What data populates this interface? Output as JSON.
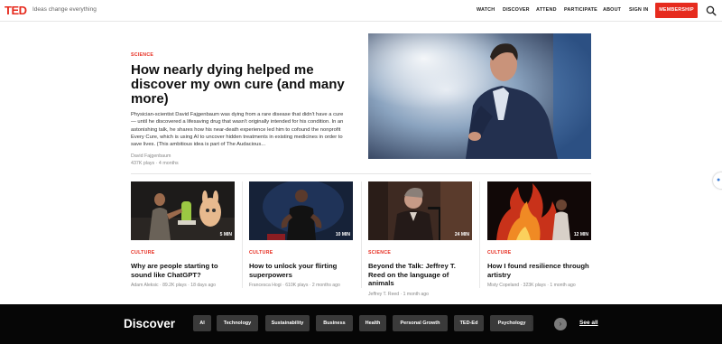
{
  "header": {
    "logo": "TED",
    "tagline": "Ideas change everything",
    "nav": [
      "WATCH",
      "DISCOVER",
      "ATTEND",
      "PARTICIPATE",
      "ABOUT",
      "SIGN IN"
    ],
    "membership_label": "MEMBERSHIP",
    "brand_color": "#e62b1e"
  },
  "hero": {
    "category": "SCIENCE",
    "title": "How nearly dying helped me discover my own cure (and many more)",
    "description": "Physician-scientist David Fajgenbaum was dying from a rare disease that didn't have a cure — until he discovered a lifesaving drug that wasn't originally intended for his condition. In an astonishing talk, he shares how his near-death experience led him to cofound the nonprofit Every Cure, which is using AI to uncover hidden treatments in existing medicines in order to save lives. (This ambitious idea is part of The Audacious...",
    "speaker": "David Fajgenbaum",
    "stats": "437K plays · 4 months"
  },
  "cards": [
    {
      "category": "CULTURE",
      "title": "Why are people starting to sound like ChatGPT?",
      "meta": "Adam Aleksic · 89.2K plays · 18 days ago",
      "duration": "5 MIN"
    },
    {
      "category": "CULTURE",
      "title": "How to unlock your flirting superpowers",
      "meta": "Francesca Hogi · 610K plays · 2 months ago",
      "duration": "10 MIN"
    },
    {
      "category": "SCIENCE",
      "title": "Beyond the Talk: Jeffrey T. Reed on the language of animals",
      "meta": "Jeffrey T. Reed · 1 month ago",
      "duration": "24 MIN"
    },
    {
      "category": "CULTURE",
      "title": "How I found resilience through artistry",
      "meta": "Misty Copeland · 323K plays · 1 month ago",
      "duration": "12 MIN"
    }
  ],
  "discover": {
    "title": "Discover",
    "topics": [
      "AI",
      "Technology",
      "Sustainability",
      "Business",
      "Health",
      "Personal Growth",
      "TED-Ed",
      "Psychology"
    ],
    "see_all": "See all"
  }
}
